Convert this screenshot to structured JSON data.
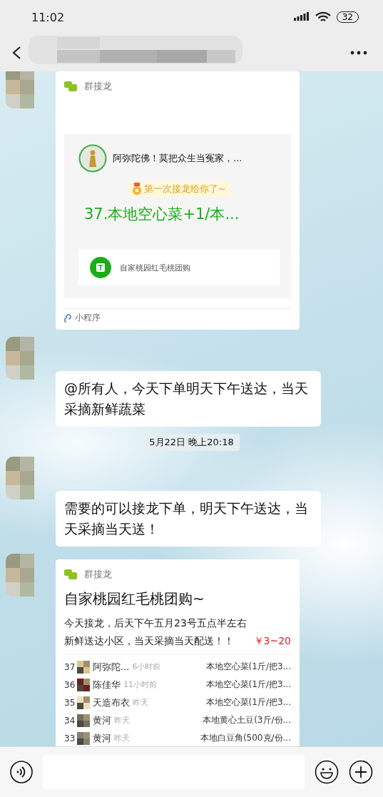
{
  "status_bar": {
    "time": "11:02",
    "battery": "32"
  },
  "messages": [
    {
      "kind": "mini_program",
      "source": "群接龙",
      "preview": {
        "author_line": "阿弥陀佛！莫把众生当冤家，...",
        "badge": "第一次接龙给你了~",
        "headline": "37.本地空心菜+1/本...",
        "app_name": "自家桃园红毛桃团购"
      },
      "footer": "小程序"
    },
    {
      "kind": "text",
      "text": "@所有人，今天下单明天下午送达，当天采摘新鲜蔬菜"
    },
    {
      "kind": "time",
      "text": "5月22日 晚上20:18"
    },
    {
      "kind": "text",
      "text": "需要的可以接龙下单，明天下午送达，当天采摘当天送！"
    },
    {
      "kind": "solitaire",
      "source": "群接龙",
      "title": "自家桃园红毛桃团购~",
      "description": "今天接龙，后天下午五月23号五点半左右新鲜送达小区，当天采摘当天配送！！",
      "price": "￥3~20",
      "entries": [
        {
          "number": "37",
          "name": "阿弥陀...",
          "time": "6小时前",
          "item": "本地空心菜(1斤/把3..."
        },
        {
          "number": "36",
          "name": "陈佳华",
          "time": "11小时前",
          "item": "本地空心菜(1斤/把3..."
        },
        {
          "number": "35",
          "name": "天造布衣",
          "time": "昨天",
          "item": "本地空心菜(1斤/把3..."
        },
        {
          "number": "34",
          "name": "黄河",
          "time": "昨天",
          "item": "本地黄心土豆(3斤/份..."
        },
        {
          "number": "33",
          "name": "黄河",
          "time": "昨天",
          "item": "本地白豆角(500克/份..."
        }
      ]
    }
  ]
}
